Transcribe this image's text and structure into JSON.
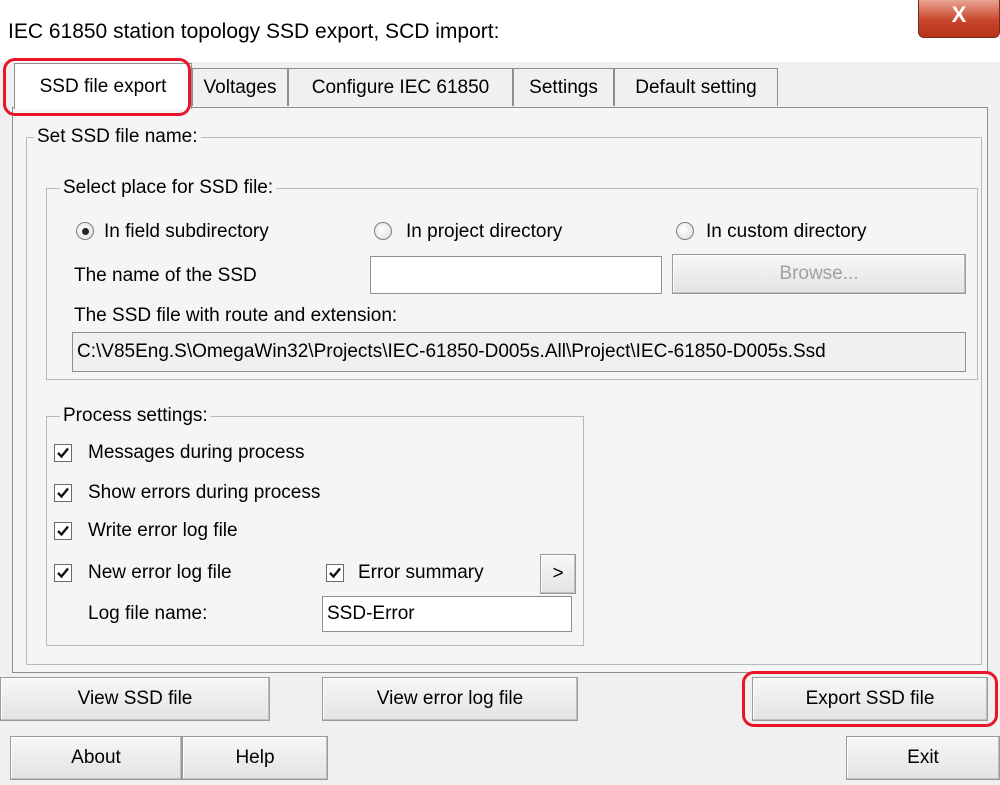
{
  "window": {
    "title": "IEC 61850 station topology SSD export, SCD import:",
    "close_label": "X"
  },
  "tabs": [
    {
      "label": "SSD file export",
      "active": true
    },
    {
      "label": "Voltages",
      "active": false
    },
    {
      "label": "Configure IEC 61850",
      "active": false
    },
    {
      "label": "Settings",
      "active": false
    },
    {
      "label": "Default setting",
      "active": false
    }
  ],
  "set_ssd": {
    "legend": "Set SSD file name:",
    "select_place": {
      "legend": "Select place for SSD file:",
      "options": [
        {
          "label": "In field subdirectory",
          "selected": true
        },
        {
          "label": "In project directory",
          "selected": false
        },
        {
          "label": "In custom directory",
          "selected": false
        }
      ]
    },
    "name_label": "The name of the SSD",
    "name_value": "",
    "browse_label": "Browse...",
    "route_label": "The SSD file with route and extension:",
    "route_value": "C:\\V85Eng.S\\OmegaWin32\\Projects\\IEC-61850-D005s.All\\Project\\IEC-61850-D005s.Ssd"
  },
  "process": {
    "legend": "Process settings:",
    "messages": {
      "label": "Messages during process",
      "checked": true
    },
    "show_errors": {
      "label": "Show errors during process",
      "checked": true
    },
    "write_log": {
      "label": "Write error log file",
      "checked": true
    },
    "new_log": {
      "label": "New error log file",
      "checked": true
    },
    "error_summary": {
      "label": "Error summary",
      "checked": true
    },
    "arrow_label": ">",
    "log_name_label": "Log file name:",
    "log_name_value": "SSD-Error"
  },
  "actions": {
    "view_ssd": "View SSD file",
    "view_log": "View error log file",
    "export": "Export SSD file"
  },
  "footer": {
    "about": "About",
    "help": "Help",
    "exit": "Exit"
  },
  "colors": {
    "highlight": "#e8152a",
    "close_button": "#c8462c"
  }
}
